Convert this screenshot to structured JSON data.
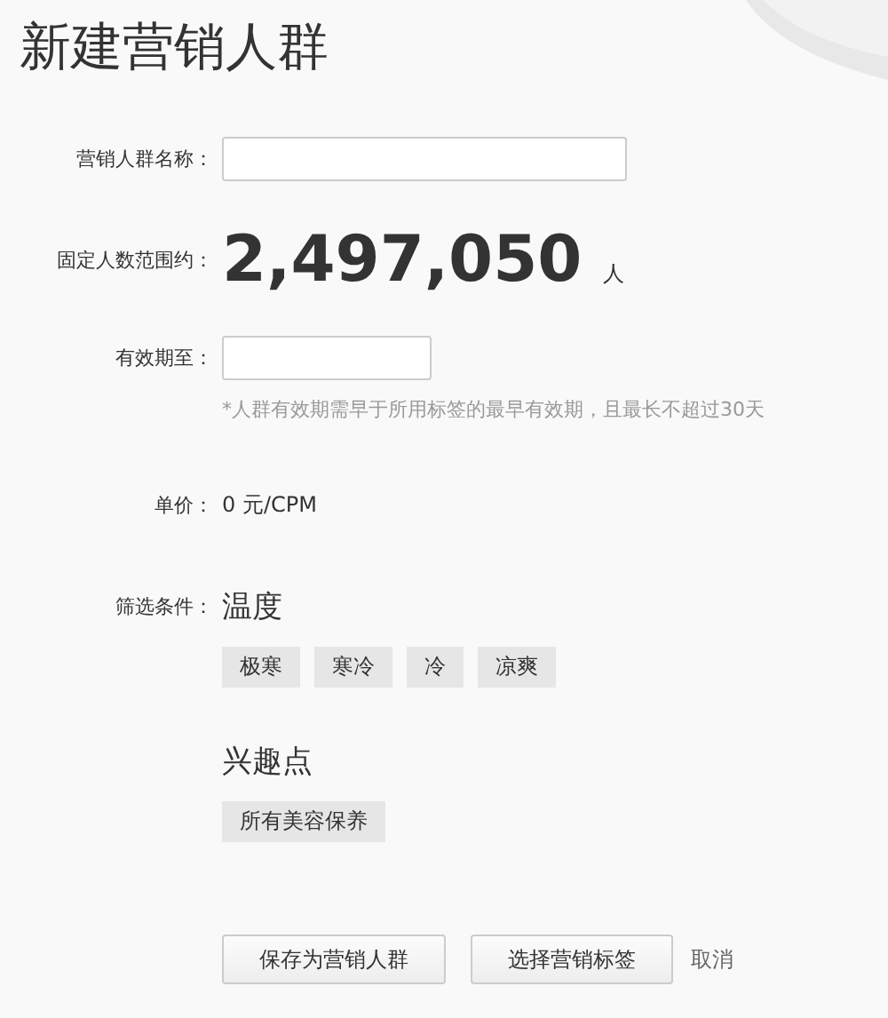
{
  "title": "新建营销人群",
  "name_field": {
    "label": "营销人群名称："
  },
  "count": {
    "label": "固定人数范围约：",
    "value": "2,497,050",
    "unit": "人"
  },
  "expiry_field": {
    "label": "有效期至：",
    "hint": "*人群有效期需早于所用标签的最早有效期，且最长不超过30天"
  },
  "price": {
    "label": "单价：",
    "value": "0 元/CPM"
  },
  "filters": {
    "label": "筛选条件：",
    "groups": [
      {
        "title": "温度",
        "tags": [
          "极寒",
          "寒冷",
          "冷",
          "凉爽"
        ]
      },
      {
        "title": "兴趣点",
        "tags": [
          "所有美容保养"
        ]
      }
    ]
  },
  "buttons": [
    {
      "label": "保存为营销人群",
      "kind": "button"
    },
    {
      "label": "选择营销标签",
      "kind": "button"
    },
    {
      "label": "取消",
      "kind": "link"
    }
  ]
}
